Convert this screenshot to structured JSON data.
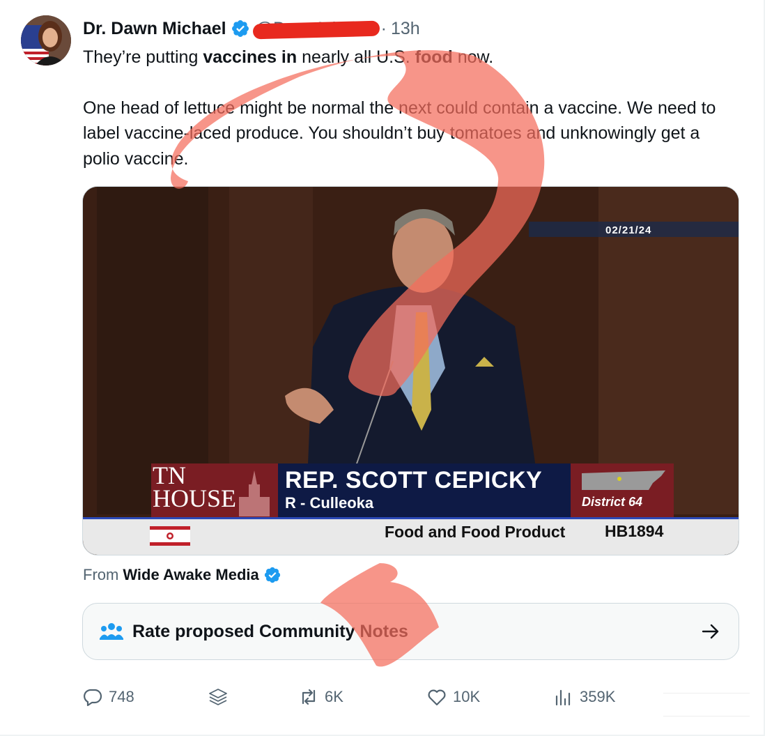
{
  "tweet": {
    "author_name": "Dr. Dawn Michael",
    "handle": "@DawnMission",
    "separator": "·",
    "time": "13h",
    "text_line1_prefix": "They’re putting ",
    "text_line1_bold1": "vaccines in",
    "text_line1_mid": " nearly all U.S. ",
    "text_line1_bold2": "food",
    "text_line1_suffix": " now.",
    "paragraph2": "One head of lettuce might be normal the next could contain a vaccine. We need to label vaccine-laced produce. You shouldn’t buy tomatoes and unknowingly get a polio vaccine."
  },
  "video": {
    "date_stamp": "02/21/24",
    "chyron_org_line1": "TN",
    "chyron_org_line2": "HOUSE",
    "rep_name": "REP. SCOTT CEPICKY",
    "rep_party": "R - Culleoka",
    "district": "District 64",
    "bill_topic": "Food and Food Product",
    "bill_number": "HB1894"
  },
  "source": {
    "prefix": "From",
    "name": "Wide Awake Media"
  },
  "community_notes": {
    "label": "Rate proposed Community Notes"
  },
  "actions": {
    "replies": "748",
    "retweets": "6K",
    "likes": "10K",
    "views": "359K"
  },
  "colors": {
    "verified_blue": "#1d9bf0",
    "muted_text": "#536471",
    "primary_text": "#0f1419",
    "scribble_red": "#f46c5c",
    "strike_red": "#e8291e"
  },
  "icons": [
    "verified-badge-icon",
    "community-people-icon",
    "arrow-right-icon",
    "reply-icon",
    "layers-icon",
    "retweet-icon",
    "heart-icon",
    "views-icon"
  ]
}
